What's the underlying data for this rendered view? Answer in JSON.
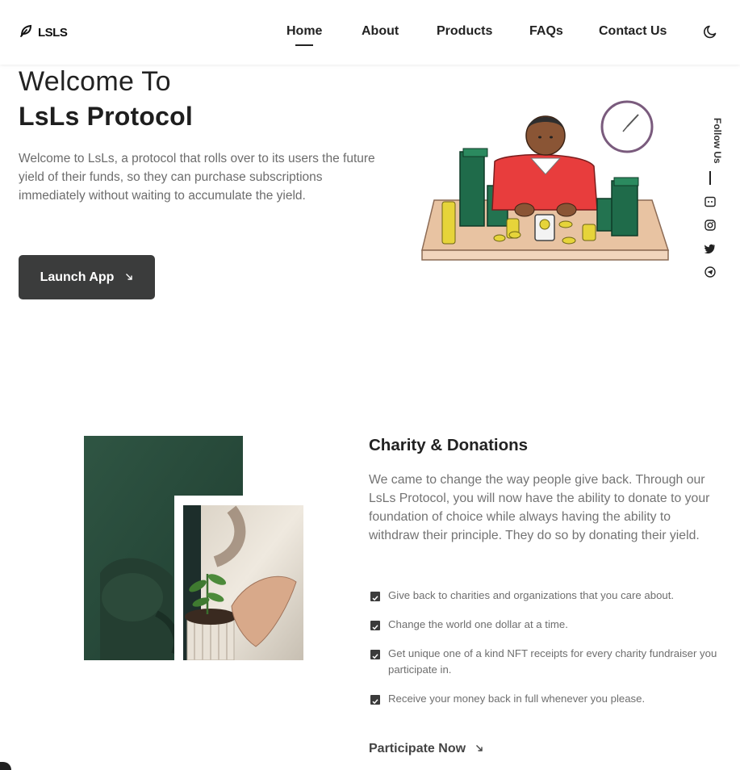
{
  "brand": {
    "name": "LSLS",
    "icon": "leaf-icon"
  },
  "nav": {
    "items": [
      {
        "label": "Home",
        "active": true
      },
      {
        "label": "About",
        "active": false
      },
      {
        "label": "Products",
        "active": false
      },
      {
        "label": "FAQs",
        "active": false
      },
      {
        "label": "Contact Us",
        "active": false
      }
    ],
    "theme_icon": "moon-icon"
  },
  "hero": {
    "welcome": "Welcome To",
    "title": "LsLs Protocol",
    "description": "Welcome to LsLs, a protocol that rolls over to its users the future yield of their funds, so they can purchase subscriptions immediately without waiting to accumulate the yield.",
    "cta_label": "Launch App",
    "cta_icon": "arrow-down-right-icon",
    "illustration": "man-counting-money-illustration"
  },
  "social": {
    "label": "Follow Us",
    "icons": [
      "discord-icon",
      "instagram-icon",
      "twitter-icon",
      "telegram-icon"
    ]
  },
  "charity": {
    "title": "Charity & Donations",
    "description": "We came to change the way people give back. Through our LsLs Protocol, you will now have the ability to donate to your foundation of choice while always having the ability to withdraw their principle. They do so by donating their yield.",
    "features": [
      "Give back to charities and organizations that you care about.",
      "Change the world one dollar at a time.",
      "Get unique one of a kind NFT receipts for every charity fundraiser you participate in.",
      "Receive your money back in full whenever you please."
    ],
    "cta_label": "Participate Now",
    "cta_icon": "arrow-down-right-icon"
  },
  "colors": {
    "text_dark": "#222222",
    "text_muted": "#6c6c6c",
    "button_bg": "#3b3c3c",
    "photo_green": "#2d5240"
  }
}
